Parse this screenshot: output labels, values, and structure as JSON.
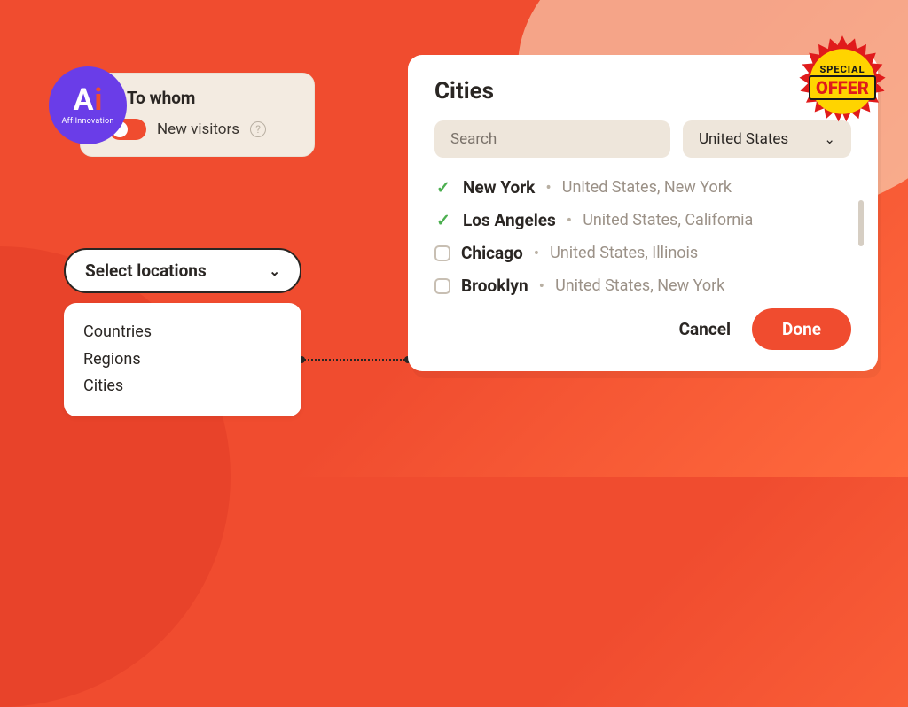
{
  "logo": {
    "letters_a": "A",
    "letters_i": "i",
    "sub": "AffiInnovation"
  },
  "towhom": {
    "title": "To whom",
    "toggle_label": "New visitors",
    "help": "?"
  },
  "select_locations": {
    "label": "Select locations",
    "menu": [
      "Countries",
      "Regions",
      "Cities"
    ]
  },
  "cities": {
    "title": "Cities",
    "search_placeholder": "Search",
    "country": "United States",
    "list": [
      {
        "checked": true,
        "name": "New York",
        "sub": "United States, New York"
      },
      {
        "checked": true,
        "name": "Los Angeles",
        "sub": "United States, California"
      },
      {
        "checked": false,
        "name": "Chicago",
        "sub": "United States, Illinois"
      },
      {
        "checked": false,
        "name": "Brooklyn",
        "sub": "United States, New York"
      }
    ],
    "cancel": "Cancel",
    "done": "Done"
  },
  "badge": {
    "line1": "SPECIAL",
    "line2": "OFFER"
  },
  "colors": {
    "accent": "#f04c2f",
    "success": "#4caf50"
  }
}
